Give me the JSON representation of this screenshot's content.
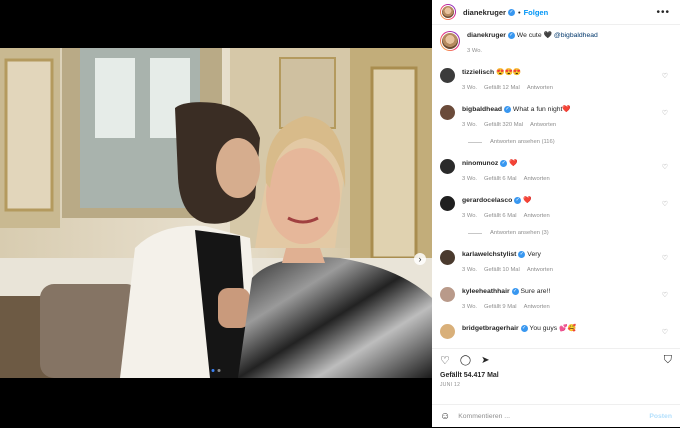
{
  "post": {
    "username": "dianekruger",
    "follow_label": "Folgen",
    "more_label": "•••",
    "caption_text": "We cute 🖤",
    "caption_mention": "@bigbaldhead",
    "caption_time": "3 Wo."
  },
  "comments": [
    {
      "user": "tizzielisch",
      "verified": false,
      "text": "😍😍😍",
      "time": "3 Wo.",
      "likes": "Gefällt 12 Mal",
      "reply": "Antworten",
      "avatar": "#3b3b3b"
    },
    {
      "user": "bigbaldhead",
      "verified": true,
      "text": "What a fun night❤️",
      "time": "3 Wo.",
      "likes": "Gefällt 320 Mal",
      "reply": "Antworten",
      "avatar": "#6b4b3a",
      "view_replies": "Antworten ansehen (116)"
    },
    {
      "user": "ninomunoz",
      "verified": true,
      "text": "❤️",
      "time": "3 Wo.",
      "likes": "Gefällt 6 Mal",
      "reply": "Antworten",
      "avatar": "#2b2b2b"
    },
    {
      "user": "gerardocelasco",
      "verified": true,
      "text": "❤️",
      "time": "3 Wo.",
      "likes": "Gefällt 6 Mal",
      "reply": "Antworten",
      "avatar": "#1f1f1f",
      "view_replies": "Antworten ansehen (3)"
    },
    {
      "user": "karlawelchstylist",
      "verified": true,
      "text": "Very",
      "time": "3 Wo.",
      "likes": "Gefällt 10 Mal",
      "reply": "Antworten",
      "avatar": "#4a3a2e"
    },
    {
      "user": "kyleeheathhair",
      "verified": true,
      "text": "Sure are!!",
      "time": "3 Wo.",
      "likes": "Gefällt 9 Mal",
      "reply": "Antworten",
      "avatar": "#b99a8a"
    },
    {
      "user": "bridgetbragerhair",
      "verified": true,
      "text": "You guys 💕🥰",
      "time": "",
      "likes": "",
      "reply": "",
      "avatar": "#d9b07a"
    }
  ],
  "footer": {
    "likes": "Gefällt 54.417 Mal",
    "date": "JUNI 12",
    "comment_placeholder": "Kommentieren ...",
    "post_label": "Posten"
  },
  "icons": {
    "heart": "♡",
    "comment": "◯",
    "share": "➤",
    "save": "⛉",
    "emoji": "☺",
    "next": "›"
  }
}
